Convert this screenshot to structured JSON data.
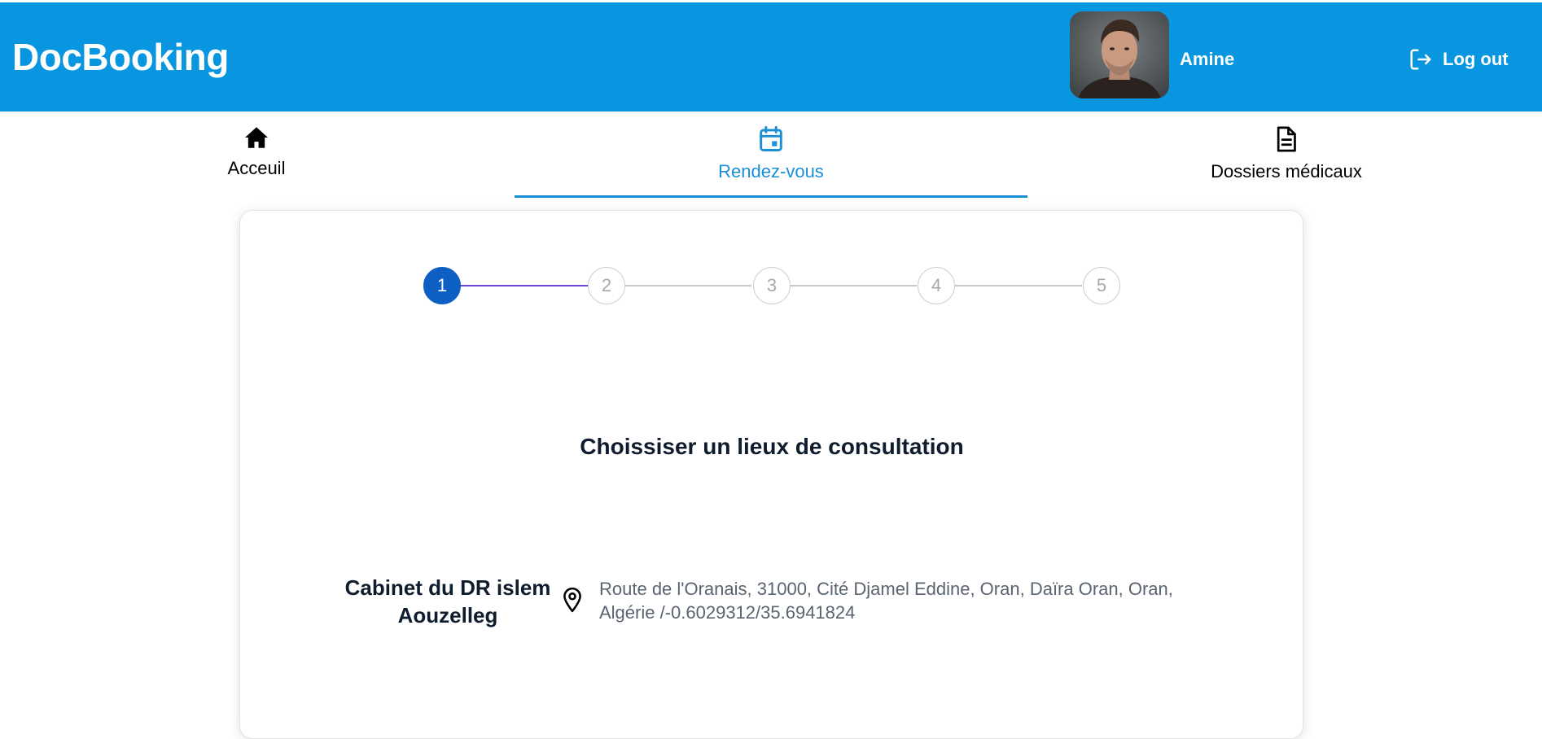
{
  "app": {
    "brand": "DocBooking"
  },
  "user": {
    "name": "Amine",
    "logout_label": "Log out"
  },
  "tabs": [
    {
      "label": "Acceuil",
      "icon": "home-icon",
      "active": false
    },
    {
      "label": "Rendez-vous",
      "icon": "calendar-icon",
      "active": true
    },
    {
      "label": "Dossiers médicaux",
      "icon": "document-icon",
      "active": false
    }
  ],
  "stepper": {
    "steps": [
      "1",
      "2",
      "3",
      "4",
      "5"
    ],
    "current_step": 1
  },
  "content": {
    "title": "Choissiser un lieux de consultation",
    "locations": [
      {
        "name": "Cabinet du DR islem Aouzelleg",
        "icon": "location-pin-icon",
        "address": "Route de l'Oranais, 31000, Cité Djamel Eddine, Oran, Daïra Oran, Oran, Algérie /-0.6029312/35.6941824"
      }
    ]
  },
  "colors": {
    "header_bg": "#0796df",
    "accent": "#1a8fd5",
    "step_active": "#0e5fc3",
    "step_progress": "#6a45d6"
  }
}
